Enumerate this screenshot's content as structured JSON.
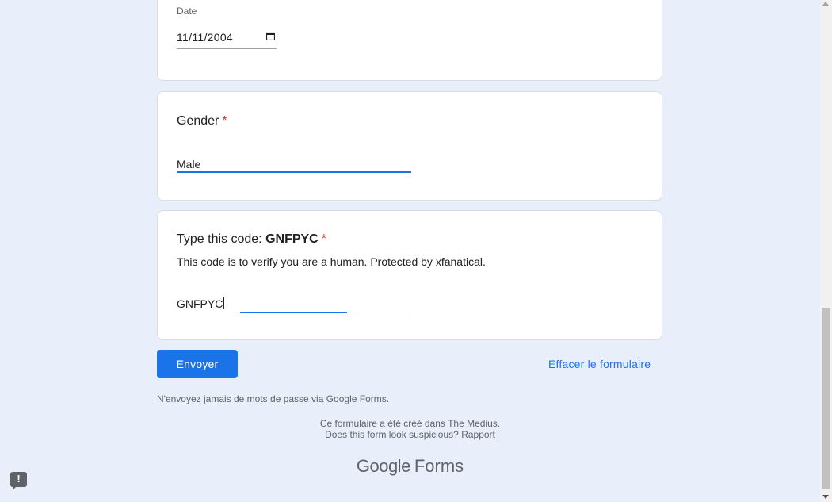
{
  "date_question": {
    "label": "Date",
    "value": "11/11/2004"
  },
  "gender_question": {
    "title": "Gender",
    "required_mark": "*",
    "value": "Male"
  },
  "code_question": {
    "title_prefix": "Type this code: ",
    "code": "GNFPYC",
    "required_mark": "*",
    "description": "This code is to verify you are a human. Protected by xfanatical.",
    "value": "GNFPYC"
  },
  "actions": {
    "submit_label": "Envoyer",
    "clear_label": "Effacer le formulaire"
  },
  "footer": {
    "password_warning": "N'envoyez jamais de mots de passe via Google Forms.",
    "created_in": "Ce formulaire a été créé dans The Medius.",
    "suspicious_text": "Does this form look suspicious?",
    "report_label": "Rapport",
    "logo_google": "Google",
    "logo_forms": "Forms"
  },
  "feedback": {
    "icon": "!"
  },
  "colors": {
    "background": "#e8effb",
    "accent": "#1a73e8",
    "required": "#d93025"
  }
}
